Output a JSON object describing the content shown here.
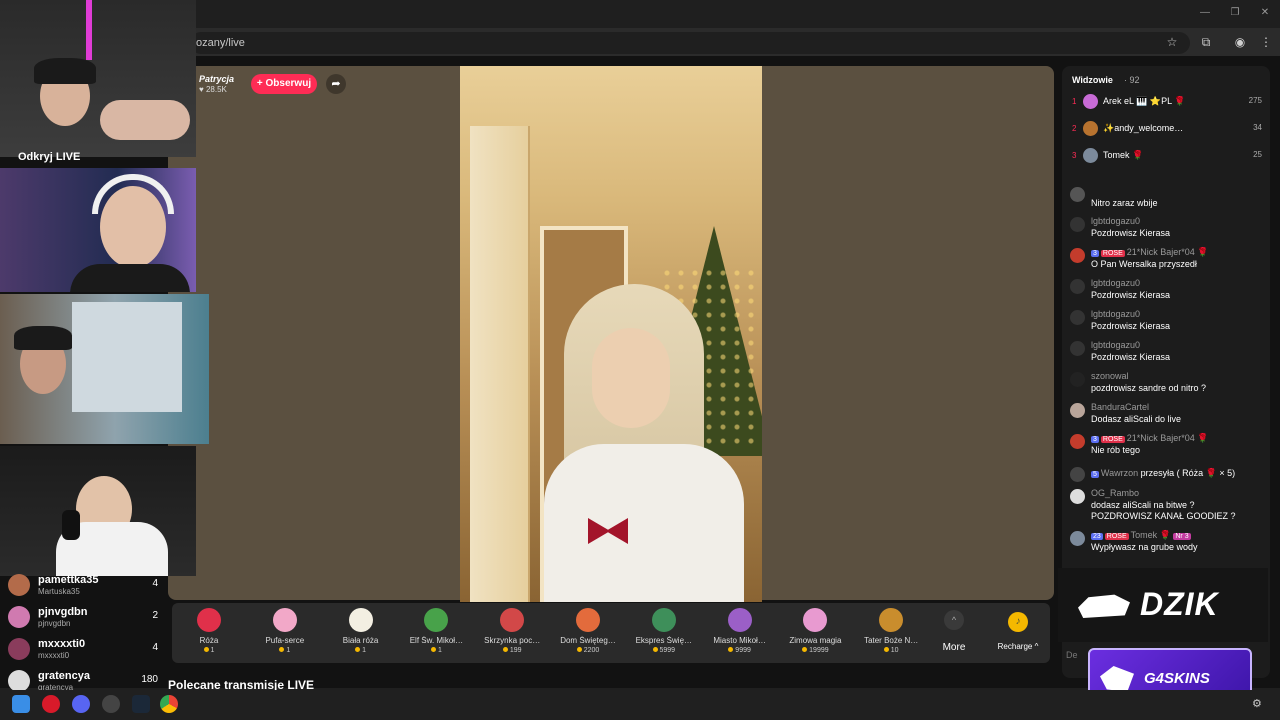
{
  "browser": {
    "url": "ozany/live"
  },
  "streamer": {
    "name": "Patrycja",
    "likes": "28.5K",
    "follow_label": "+ Obserwuj"
  },
  "gifts": [
    {
      "name": "Róża",
      "price": "1",
      "color": "#e0304a"
    },
    {
      "name": "Pufa-serce",
      "price": "1",
      "color": "#f2a8c8"
    },
    {
      "name": "Biała róża",
      "price": "1",
      "color": "#f3efe2"
    },
    {
      "name": "Elf Św. Mikoł…",
      "price": "1",
      "color": "#48a24a"
    },
    {
      "name": "Skrzynka poc…",
      "price": "199",
      "color": "#d24848"
    },
    {
      "name": "Dom Święteg…",
      "price": "2200",
      "color": "#e36b3c"
    },
    {
      "name": "Ekspres Świę…",
      "price": "5999",
      "color": "#3e8f5a"
    },
    {
      "name": "Miasto Mikoł…",
      "price": "9999",
      "color": "#9b5fc7"
    },
    {
      "name": "Zimowa magia",
      "price": "19999",
      "color": "#e89ad0"
    },
    {
      "name": "Tater Boże N…",
      "price": "10",
      "color": "#c98d2d"
    }
  ],
  "more_label": "More",
  "recharge_label": "Recharge ^",
  "recommended_label": "Polecane transmisje LIVE",
  "viewers": {
    "title": "Widzowie",
    "count": "· 92",
    "top": [
      {
        "rank": "1",
        "name": "Arek eL 🎹 ⭐PL 🌹",
        "score": "275",
        "color": "#c86bd6"
      },
      {
        "rank": "2",
        "name": "✨andy_welcome…",
        "score": "34",
        "color": "#b8732f"
      },
      {
        "rank": "3",
        "name": "Tomek 🌹",
        "score": "25",
        "color": "#7c8a9b"
      }
    ]
  },
  "chat": [
    {
      "user": "",
      "text": "Nitro zaraz wbije",
      "color": "#555"
    },
    {
      "user": "lgbtdogazu0",
      "text": "Pozdrowisz Kierasa",
      "color": "#333"
    },
    {
      "user": "21*Nick Bajer*04 🌹",
      "text": "O Pan Wersalka przyszedł",
      "color": "#c43c2c",
      "badges": [
        "3",
        "ROSE"
      ]
    },
    {
      "user": "lgbtdogazu0",
      "text": "Pozdrowisz Kierasa",
      "color": "#333"
    },
    {
      "user": "lgbtdogazu0",
      "text": "Pozdrowisz Kierasa",
      "color": "#333"
    },
    {
      "user": "lgbtdogazu0",
      "text": "Pozdrowisz Kierasa",
      "color": "#333"
    },
    {
      "user": "szonowal",
      "text": "pozdrowisz sandre od nitro ?",
      "color": "#222"
    },
    {
      "user": "BanduraCartel",
      "text": "Dodasz aliScali do live",
      "color": "#b9a59a"
    },
    {
      "user": "21*Nick Bajer*04 🌹",
      "text": "Nie rób tego",
      "color": "#c43c2c",
      "badges": [
        "3",
        "ROSE"
      ]
    },
    {
      "user": "Wawrzon",
      "text": "",
      "color": "#444",
      "badges": [
        "5"
      ],
      "gift": "przesyła ( Róża 🌹 × 5)"
    },
    {
      "user": "OG_Rambo",
      "text": "dodasz aliScali na bitwe ?",
      "text2": "POZDROWISZ KANAŁ GOODIEZ ?",
      "color": "#ddd"
    },
    {
      "user": "Tomek 🌹",
      "text": "Wypływasz na grube wody",
      "color": "#7c8a9b",
      "badges": [
        "23",
        "ROSE"
      ],
      "extra": "Nr 3"
    }
  ],
  "sponsors": {
    "dzik": "DZIK",
    "g4": "G4SKINS"
  },
  "left_panel": {
    "odkryj": "Odkryj LIVE",
    "users": [
      {
        "name": "pamettka35",
        "sub": "Martuska35",
        "count": "4",
        "color": "#b36b4a"
      },
      {
        "name": "pjnvgdbn",
        "sub": "pjnvgdbn",
        "count": "2",
        "color": "#d07ab0"
      },
      {
        "name": "mxxxxti0",
        "sub": "mxxxxti0",
        "count": "4",
        "color": "#8a3c5c"
      },
      {
        "name": "gratencya",
        "sub": "gratencya",
        "count": "180",
        "color": "#ddd"
      }
    ]
  },
  "chat_input_placeholder": "De"
}
